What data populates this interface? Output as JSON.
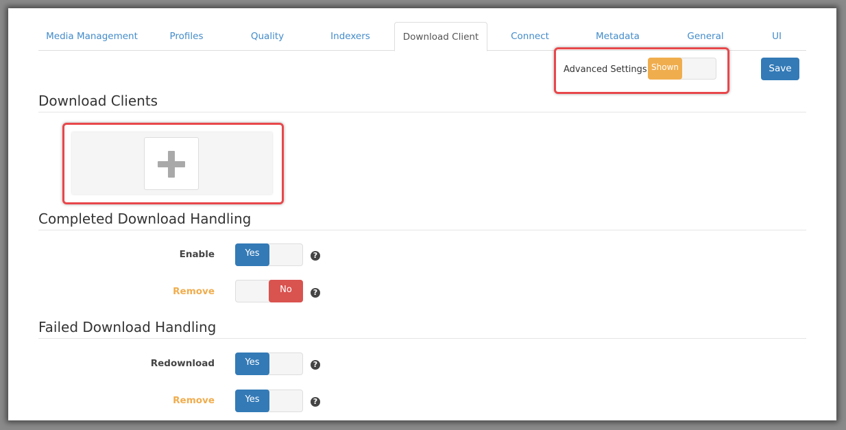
{
  "tabs": [
    {
      "label": "Media Management"
    },
    {
      "label": "Profiles"
    },
    {
      "label": "Quality"
    },
    {
      "label": "Indexers"
    },
    {
      "label": "Download Client",
      "active": true
    },
    {
      "label": "Connect"
    },
    {
      "label": "Metadata"
    },
    {
      "label": "General"
    },
    {
      "label": "UI"
    }
  ],
  "toolbar": {
    "advanced_label": "Advanced Settings",
    "advanced_state": "Shown",
    "save_label": "Save"
  },
  "sections": {
    "download_clients": "Download Clients",
    "completed": "Completed Download Handling",
    "failed": "Failed Download Handling"
  },
  "completed": {
    "enable_label": "Enable",
    "enable_value": "Yes",
    "remove_label": "Remove",
    "remove_value": "No"
  },
  "failed": {
    "redownload_label": "Redownload",
    "redownload_value": "Yes",
    "remove_label": "Remove",
    "remove_value": "Yes"
  },
  "help_glyph": "?",
  "colors": {
    "primary": "#337ab7",
    "danger": "#d9534f",
    "warning": "#f0ad4e",
    "highlight": "#e8474b"
  }
}
